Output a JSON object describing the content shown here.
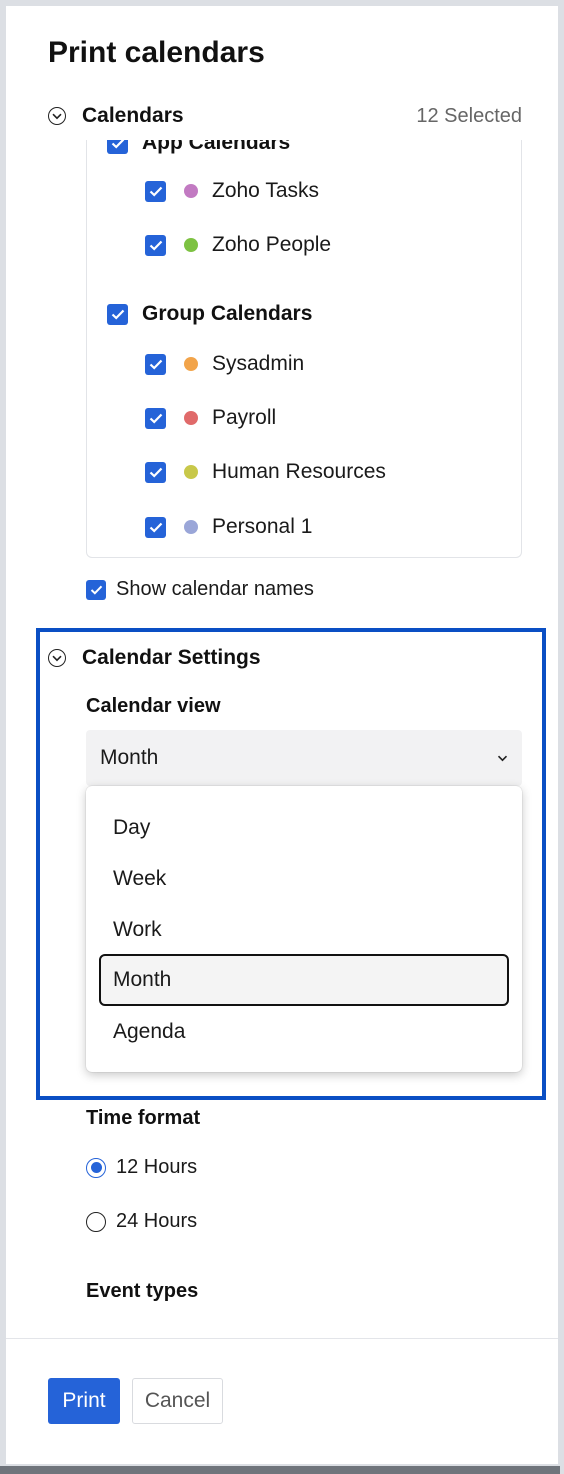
{
  "dialog": {
    "title": "Print calendars"
  },
  "calendars_section": {
    "title": "Calendars",
    "selected_count": "12 Selected",
    "app_group_label": "App Calendars",
    "app_items": [
      {
        "label": "Zoho Tasks",
        "color": "#c27ac2",
        "checked": true
      },
      {
        "label": "Zoho People",
        "color": "#7dc242",
        "checked": true
      }
    ],
    "group_label": "Group Calendars",
    "group_items": [
      {
        "label": "Sysadmin",
        "color": "#f2a44a",
        "checked": true
      },
      {
        "label": "Payroll",
        "color": "#e06a6a",
        "checked": true
      },
      {
        "label": "Human Resources",
        "color": "#c8c84a",
        "checked": true
      },
      {
        "label": "Personal 1",
        "color": "#9aa6d8",
        "checked": true
      }
    ],
    "show_names_label": "Show calendar names",
    "show_names_checked": true
  },
  "settings_section": {
    "title": "Calendar Settings",
    "view_label": "Calendar view",
    "view_value": "Month",
    "view_options": [
      "Day",
      "Week",
      "Work",
      "Month",
      "Agenda"
    ],
    "time_format_label": "Time format",
    "time_options": [
      {
        "label": "12 Hours",
        "selected": true
      },
      {
        "label": "24 Hours",
        "selected": false
      }
    ],
    "event_types_label": "Event types"
  },
  "footer": {
    "print_label": "Print",
    "cancel_label": "Cancel"
  },
  "colors": {
    "accent": "#2563d8",
    "highlight_border": "#0a4fc4"
  }
}
